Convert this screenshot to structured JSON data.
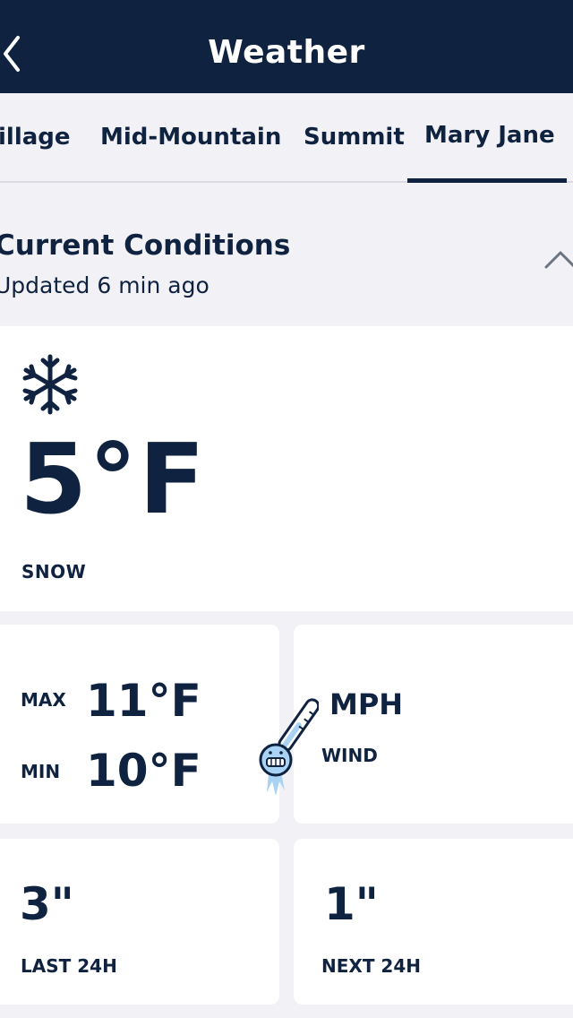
{
  "header": {
    "title": "Weather",
    "back_icon": "chevron-left-icon"
  },
  "tabs": [
    {
      "label": "illage",
      "selected": false
    },
    {
      "label": "Mid-Mountain",
      "selected": false
    },
    {
      "label": "Summit",
      "selected": false
    },
    {
      "label": "Mary Jane",
      "selected": true
    }
  ],
  "current": {
    "title": "Current Conditions",
    "updated": "Updated 6 min ago",
    "collapse_icon": "chevron-up-icon",
    "icon": "snowflake-icon",
    "temperature": "5°F",
    "condition": "SNOW"
  },
  "temps": {
    "max_label": "MAX",
    "max_value": "11°F",
    "min_label": "MIN",
    "min_value": "10°F",
    "icon": "thermometer-icon"
  },
  "wind": {
    "value": "MPH",
    "label": "WIND"
  },
  "snowfall": {
    "last_value": "3\"",
    "last_label": "LAST 24H",
    "next_value": "1\"",
    "next_label": "NEXT 24H"
  },
  "colors": {
    "primary": "#0f2240",
    "background": "#f2f1f5",
    "card": "#ffffff",
    "ice": "#a9d3f5"
  }
}
